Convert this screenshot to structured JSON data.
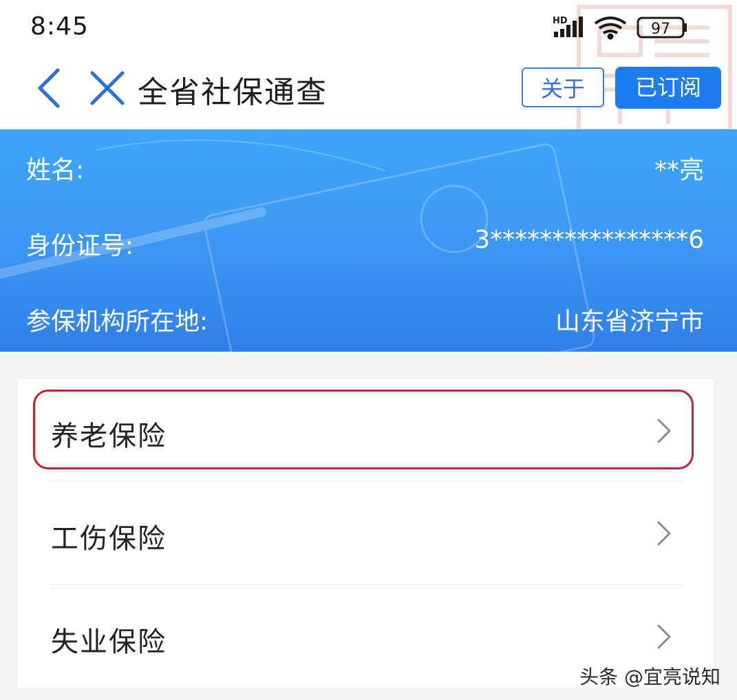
{
  "status_bar": {
    "time": "8:45",
    "network_label": "HD",
    "battery": "97",
    "icons": [
      "signal-icon",
      "wifi-icon",
      "battery-icon"
    ]
  },
  "nav": {
    "title": "全省社保通查",
    "about_label": "关于",
    "subscribed_label": "已订阅",
    "icons": [
      "back-chevron-icon",
      "close-icon"
    ]
  },
  "info": {
    "name_label": "姓名:",
    "name_value": "**亮",
    "id_label": "身份证号:",
    "id_value": "3****************6",
    "location_label": "参保机构所在地:",
    "location_value": "山东省济宁市"
  },
  "menu": {
    "items": [
      {
        "label": "养老保险",
        "highlighted": true
      },
      {
        "label": "工伤保险",
        "highlighted": false
      },
      {
        "label": "失业保险",
        "highlighted": false
      }
    ]
  },
  "watermark": "头条 @宜亮说知",
  "colors": {
    "primary": "#1c7cf0",
    "banner_top": "#3ba6f7",
    "banner_bottom": "#2f7fe9",
    "highlight_border": "#c8202c",
    "page_bg": "#f4f4f4"
  }
}
